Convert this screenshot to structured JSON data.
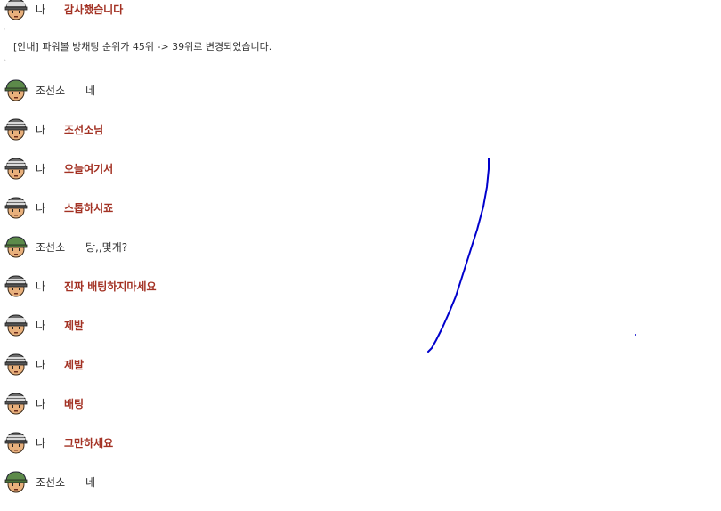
{
  "messages_top": {
    "name": "나",
    "text": "감사했습니다"
  },
  "notice": {
    "text": "[안내] 파워볼 방채팅 순위가 45위 -> 39위로 변경되었습니다."
  },
  "messages": [
    {
      "name": "조선소",
      "text": "네",
      "from_me": false
    },
    {
      "name": "나",
      "text": "조선소님",
      "from_me": true
    },
    {
      "name": "나",
      "text": "오늘여기서",
      "from_me": true
    },
    {
      "name": "나",
      "text": "스톱하시죠",
      "from_me": true
    },
    {
      "name": "조선소",
      "text": "탕,,몇개?",
      "from_me": false
    },
    {
      "name": "나",
      "text": "진짜 배팅하지마세요",
      "from_me": true
    },
    {
      "name": "나",
      "text": "제발",
      "from_me": true
    },
    {
      "name": "나",
      "text": "제발",
      "from_me": true
    },
    {
      "name": "나",
      "text": "배팅",
      "from_me": true
    },
    {
      "name": "나",
      "text": "그만하세요",
      "from_me": true
    },
    {
      "name": "조선소",
      "text": "네",
      "from_me": false
    }
  ],
  "icons": {
    "avatar_me": "soldier-striped-helmet-avatar-icon",
    "avatar_other": "soldier-green-helmet-avatar-icon"
  },
  "colors": {
    "my_message": "#a33224",
    "other_message": "#333333",
    "drawing_stroke": "#0000cc",
    "notice_border": "#cfcfcf"
  }
}
